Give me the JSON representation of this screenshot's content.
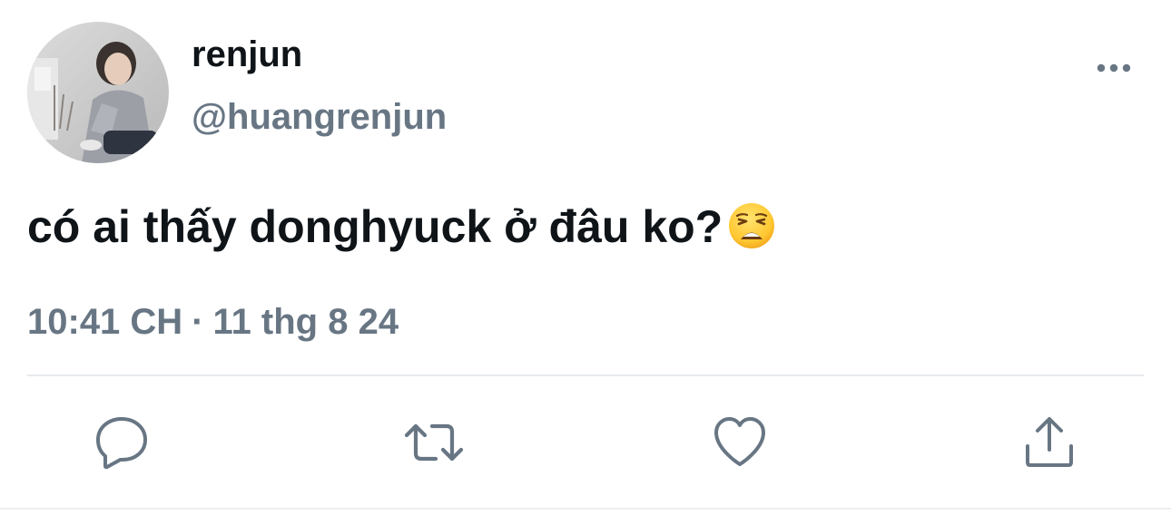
{
  "tweet": {
    "author": {
      "display_name": "renjun",
      "handle": "@huangrenjun"
    },
    "text": "có ai thấy donghyuck ở đâu ko?",
    "emoji": "weary-face",
    "time": "10:41 CH",
    "separator": "·",
    "date": "11 thg 8 24"
  },
  "actions": [
    {
      "name": "reply",
      "icon": "speech-bubble-icon"
    },
    {
      "name": "retweet",
      "icon": "retweet-icon"
    },
    {
      "name": "like",
      "icon": "heart-icon"
    },
    {
      "name": "share",
      "icon": "share-icon"
    }
  ],
  "colors": {
    "text_primary": "#0f1419",
    "text_secondary": "#687684",
    "divider": "#e6e9ec"
  }
}
